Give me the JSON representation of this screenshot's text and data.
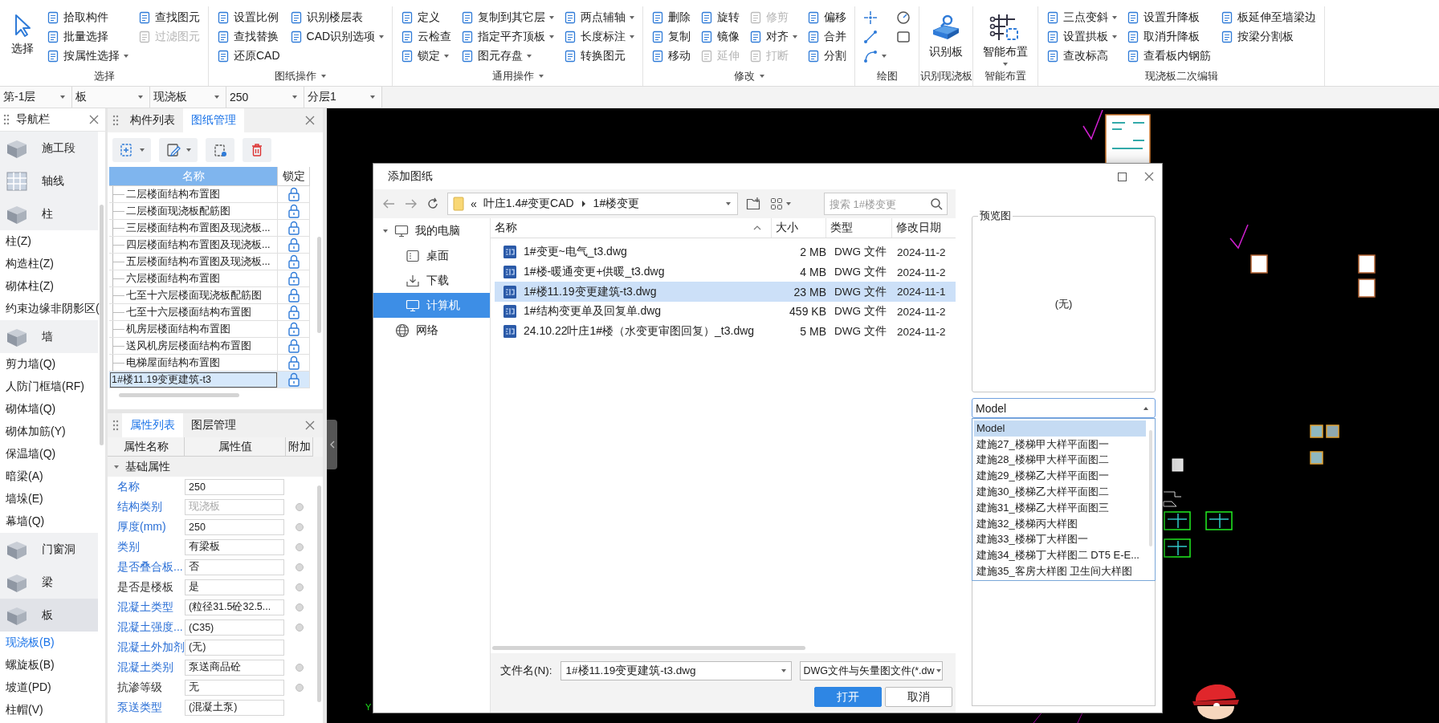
{
  "ribbon": {
    "groups": [
      {
        "label": "选择",
        "dropdown": false,
        "large": [
          {
            "label": "选择",
            "dropdown": false
          }
        ],
        "columns": [
          [
            {
              "label": "拾取构件",
              "disabled": false,
              "dropdown": false
            },
            {
              "label": "批量选择",
              "disabled": false,
              "dropdown": false
            },
            {
              "label": "按属性选择",
              "disabled": false,
              "dropdown": true
            }
          ],
          [
            {
              "label": "查找图元",
              "disabled": false,
              "dropdown": false
            },
            {
              "label": "过滤图元",
              "disabled": true,
              "dropdown": false
            }
          ]
        ]
      },
      {
        "label": "图纸操作",
        "dropdown": true,
        "columns": [
          [
            {
              "label": "设置比例",
              "disabled": false,
              "dropdown": false
            },
            {
              "label": "查找替换",
              "disabled": false,
              "dropdown": false
            },
            {
              "label": "还原CAD",
              "disabled": false,
              "dropdown": false
            }
          ],
          [
            {
              "label": "识别楼层表",
              "disabled": false,
              "dropdown": false
            },
            {
              "label": "CAD识别选项",
              "disabled": false,
              "dropdown": true
            }
          ]
        ]
      },
      {
        "label": "通用操作",
        "dropdown": true,
        "columns": [
          [
            {
              "label": "定义",
              "disabled": false,
              "dropdown": false
            },
            {
              "label": "云检查",
              "disabled": false,
              "dropdown": false
            },
            {
              "label": "锁定",
              "disabled": false,
              "dropdown": true
            }
          ],
          [
            {
              "label": "复制到其它层",
              "disabled": false,
              "dropdown": true
            },
            {
              "label": "指定平齐顶板",
              "disabled": false,
              "dropdown": true
            },
            {
              "label": "图元存盘",
              "disabled": false,
              "dropdown": true
            }
          ],
          [
            {
              "label": "两点辅轴",
              "disabled": false,
              "dropdown": true
            },
            {
              "label": "长度标注",
              "disabled": false,
              "dropdown": true
            },
            {
              "label": "转换图元",
              "disabled": false,
              "dropdown": false
            }
          ]
        ]
      },
      {
        "label": "修改",
        "dropdown": true,
        "columns": [
          [
            {
              "label": "删除",
              "disabled": false,
              "dropdown": false
            },
            {
              "label": "复制",
              "disabled": false,
              "dropdown": false
            },
            {
              "label": "移动",
              "disabled": false,
              "dropdown": false
            }
          ],
          [
            {
              "label": "旋转",
              "disabled": false,
              "dropdown": false
            },
            {
              "label": "镜像",
              "disabled": false,
              "dropdown": false
            },
            {
              "label": "延伸",
              "disabled": true,
              "dropdown": false
            }
          ],
          [
            {
              "label": "修剪",
              "disabled": true,
              "dropdown": false
            },
            {
              "label": "对齐",
              "disabled": false,
              "dropdown": true
            },
            {
              "label": "打断",
              "disabled": true,
              "dropdown": false
            }
          ],
          [
            {
              "label": "偏移",
              "disabled": false,
              "dropdown": false
            },
            {
              "label": "合并",
              "disabled": false,
              "dropdown": false
            },
            {
              "label": "分割",
              "disabled": false,
              "dropdown": false
            }
          ]
        ]
      },
      {
        "label": "绘图",
        "dropdown": false,
        "shapes": [
          [
            {
              "dropdown": false
            },
            {
              "dropdown": false
            },
            {
              "dropdown": true
            }
          ],
          [
            {
              "dropdown": false
            },
            {
              "dropdown": false
            }
          ]
        ]
      },
      {
        "label": "识别现浇板",
        "dropdown": false,
        "large": [
          {
            "label": "识别板",
            "dropdown": false
          }
        ]
      },
      {
        "label": "智能布置",
        "dropdown": false,
        "large": [
          {
            "label": "智能布置",
            "dropdown": true
          }
        ]
      },
      {
        "label": "现浇板二次编辑",
        "dropdown": false,
        "columns": [
          [
            {
              "label": "三点变斜",
              "disabled": false,
              "dropdown": true
            },
            {
              "label": "设置拱板",
              "disabled": false,
              "dropdown": true
            },
            {
              "label": "查改标高",
              "disabled": false,
              "dropdown": false
            }
          ],
          [
            {
              "label": "设置升降板",
              "disabled": false,
              "dropdown": false
            },
            {
              "label": "取消升降板",
              "disabled": false,
              "dropdown": false
            },
            {
              "label": "查看板内钢筋",
              "disabled": false,
              "dropdown": false
            }
          ],
          [
            {
              "label": "板延伸至墙梁边",
              "disabled": false,
              "dropdown": false
            },
            {
              "label": "按梁分割板",
              "disabled": false,
              "dropdown": false
            }
          ]
        ]
      }
    ]
  },
  "level_bar": {
    "selectors": [
      {
        "value": "第-1层"
      },
      {
        "value": "板"
      },
      {
        "value": "现浇板"
      },
      {
        "value": "250"
      },
      {
        "value": "分层1"
      }
    ]
  },
  "navigation": {
    "title": "导航栏",
    "categories": [
      {
        "label": "施工段",
        "selected": false
      },
      {
        "label": "轴线",
        "selected": false
      },
      {
        "label": "柱",
        "selected": false,
        "children": [
          {
            "label": "柱(Z)",
            "selected": false
          },
          {
            "label": "构造柱(Z)",
            "selected": false
          },
          {
            "label": "砌体柱(Z)",
            "selected": false
          },
          {
            "label": "约束边缘非阴影区(",
            "selected": false
          }
        ]
      },
      {
        "label": "墙",
        "selected": false,
        "children": [
          {
            "label": "剪力墙(Q)",
            "selected": false
          },
          {
            "label": "人防门框墙(RF)",
            "selected": false
          },
          {
            "label": "砌体墙(Q)",
            "selected": false
          },
          {
            "label": "砌体加筋(Y)",
            "selected": false
          },
          {
            "label": "保温墙(Q)",
            "selected": false
          },
          {
            "label": "暗梁(A)",
            "selected": false
          },
          {
            "label": "墙垛(E)",
            "selected": false
          },
          {
            "label": "幕墙(Q)",
            "selected": false
          }
        ]
      },
      {
        "label": "门窗洞",
        "selected": false
      },
      {
        "label": "梁",
        "selected": false
      },
      {
        "label": "板",
        "selected": true,
        "children": [
          {
            "label": "现浇板(B)",
            "selected": true
          },
          {
            "label": "螺旋板(B)",
            "selected": false
          },
          {
            "label": "坡道(PD)",
            "selected": false
          },
          {
            "label": "柱帽(V)",
            "selected": false
          }
        ]
      }
    ]
  },
  "drawing_panel": {
    "tabs": [
      {
        "label": "构件列表",
        "selected": false
      },
      {
        "label": "图纸管理",
        "selected": true
      }
    ],
    "toolbar": [
      {
        "dropdown": true
      },
      {
        "dropdown": true
      },
      {
        "dropdown": false
      },
      {
        "dropdown": false
      }
    ],
    "columns": [
      "名称",
      "锁定"
    ],
    "drawings": [
      {
        "children": [
          {
            "name": "二层楼面结构布置图",
            "selected": false
          },
          {
            "name": "二层楼面现浇板配筋图",
            "selected": false
          },
          {
            "name": "三层楼面结构布置图及现浇板...",
            "selected": false
          },
          {
            "name": "四层楼面结构布置图及现浇板...",
            "selected": false
          },
          {
            "name": "五层楼面结构布置图及现浇板...",
            "selected": false
          },
          {
            "name": "六层楼面结构布置图",
            "selected": false
          },
          {
            "name": "七至十六层楼面现浇板配筋图",
            "selected": false
          },
          {
            "name": "七至十六层楼面结构布置图",
            "selected": false
          },
          {
            "name": "机房层楼面结构布置图",
            "selected": false
          },
          {
            "name": "送风机房层楼面结构布置图",
            "selected": false
          },
          {
            "name": "电梯屋面结构布置图",
            "selected": false
          }
        ]
      },
      {
        "name": "1#楼11.19变更建筑-t3",
        "selected": true
      }
    ]
  },
  "property_panel": {
    "tabs": [
      {
        "label": "属性列表",
        "selected": true
      },
      {
        "label": "图层管理",
        "selected": false
      }
    ],
    "columns": [
      "属性名称",
      "属性值",
      "附加"
    ],
    "groups": [
      {
        "label": "基础属性",
        "expanded": true,
        "properties": [
          {
            "name": "名称",
            "value": "250",
            "public": true,
            "value_disabled": false,
            "extra": false
          },
          {
            "name": "结构类别",
            "value": "现浇板",
            "public": true,
            "value_disabled": true,
            "extra": true
          },
          {
            "name": "厚度(mm)",
            "value": "250",
            "public": true,
            "value_disabled": false,
            "extra": true
          },
          {
            "name": "类别",
            "value": "有梁板",
            "public": true,
            "value_disabled": false,
            "extra": true
          },
          {
            "name": "是否叠合板...",
            "value": "否",
            "public": true,
            "value_disabled": false,
            "extra": true
          },
          {
            "name": "是否是楼板",
            "value": "是",
            "public": false,
            "value_disabled": false,
            "extra": true
          },
          {
            "name": "混凝土类型",
            "value": "(粒径31.5砼32.5...",
            "public": true,
            "value_disabled": false,
            "extra": true
          },
          {
            "name": "混凝土强度...",
            "value": "(C35)",
            "public": true,
            "value_disabled": false,
            "extra": true
          },
          {
            "name": "混凝土外加剂",
            "value": "(无)",
            "public": true,
            "value_disabled": false,
            "extra": false
          },
          {
            "name": "混凝土类别",
            "value": "泵送商品砼",
            "public": true,
            "value_disabled": false,
            "extra": true
          },
          {
            "name": "抗渗等级",
            "value": "无",
            "public": false,
            "value_disabled": false,
            "extra": true
          },
          {
            "name": "泵送类型",
            "value": "(混凝土泵)",
            "public": true,
            "value_disabled": false,
            "extra": false
          }
        ]
      }
    ]
  },
  "canvas": {
    "axis_label": "Y"
  },
  "dialog": {
    "title": "添加图纸",
    "path_prefix": "«",
    "path": [
      "叶庄1.4#变更CAD",
      "1#楼变更"
    ],
    "search_placeholder": "搜索 1#楼变更",
    "places": [
      {
        "label": "我的电脑",
        "selected": false,
        "expanded": true,
        "children": [
          {
            "label": "桌面",
            "selected": false
          },
          {
            "label": "下载",
            "selected": false
          },
          {
            "label": "计算机",
            "selected": true
          }
        ]
      },
      {
        "label": "网络",
        "selected": false
      }
    ],
    "columns": [
      "名称",
      "大小",
      "类型",
      "修改日期"
    ],
    "files": [
      {
        "name": "1#变更~电气_t3.dwg",
        "size": "2 MB",
        "type": "DWG 文件",
        "modified": "2024-11-2",
        "selected": false
      },
      {
        "name": "1#楼-暖通变更+供暖_t3.dwg",
        "size": "4 MB",
        "type": "DWG 文件",
        "modified": "2024-11-2",
        "selected": false
      },
      {
        "name": "1#楼11.19变更建筑-t3.dwg",
        "size": "23 MB",
        "type": "DWG 文件",
        "modified": "2024-11-1",
        "selected": true
      },
      {
        "name": "1#结构变更单及回复单.dwg",
        "size": "459 KB",
        "type": "DWG 文件",
        "modified": "2024-11-2",
        "selected": false
      },
      {
        "name": "24.10.22叶庄1#楼（水变更审图回复）_t3.dwg",
        "size": "5 MB",
        "type": "DWG 文件",
        "modified": "2024-11-2",
        "selected": false
      }
    ],
    "file_name_label": "文件名(N):",
    "file_name": "1#楼11.19变更建筑-t3.dwg",
    "file_type": "DWG文件与矢量图文件(*.dw",
    "buttons": [
      {
        "label": "打开",
        "kind": "primary"
      },
      {
        "label": "取消",
        "kind": "secondary"
      }
    ],
    "preview": {
      "title": "预览图",
      "content": "(无)"
    },
    "layout_select": {
      "value": "Model",
      "expanded": true,
      "options": [
        {
          "label": "Model",
          "selected": true
        },
        {
          "label": "建施27_楼梯甲大样平面图一",
          "selected": false
        },
        {
          "label": "建施28_楼梯甲大样平面图二",
          "selected": false
        },
        {
          "label": "建施29_楼梯乙大样平面图一",
          "selected": false
        },
        {
          "label": "建施30_楼梯乙大样平面图二",
          "selected": false
        },
        {
          "label": "建施31_楼梯乙大样平面图三",
          "selected": false
        },
        {
          "label": "建施32_楼梯丙大样图",
          "selected": false
        },
        {
          "label": "建施33_楼梯丁大样图一",
          "selected": false
        },
        {
          "label": "建施34_楼梯丁大样图二  DT5 E-E...",
          "selected": false
        },
        {
          "label": "建施35_客房大样图 卫生间大样图",
          "selected": false
        }
      ]
    }
  }
}
